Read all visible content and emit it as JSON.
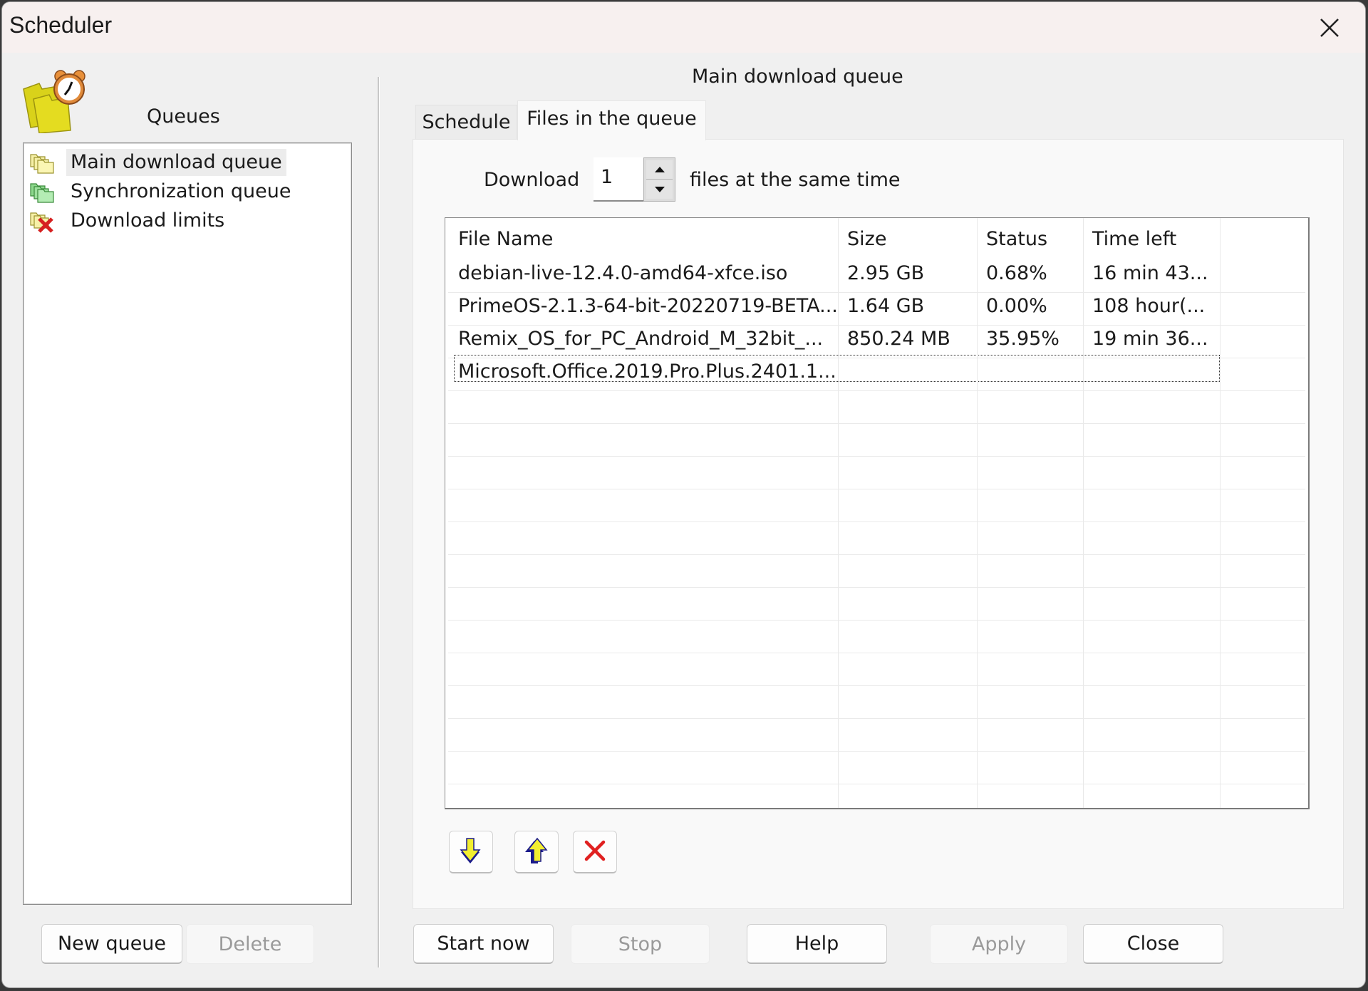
{
  "window": {
    "title": "Scheduler",
    "close_icon": "close-icon"
  },
  "sidebar": {
    "header_label": "Queues",
    "header_icon": "alarm-clock-folder-icon",
    "items": [
      {
        "label": "Main download queue",
        "icon": "yellow-folders-icon",
        "selected": true
      },
      {
        "label": "Synchronization queue",
        "icon": "green-folders-icon",
        "selected": false
      },
      {
        "label": "Download limits",
        "icon": "folders-red-x-icon",
        "selected": false
      }
    ],
    "new_queue_label": "New queue",
    "delete_label": "Delete"
  },
  "main": {
    "queue_title": "Main download queue",
    "tabs": [
      {
        "label": "Schedule",
        "active": false
      },
      {
        "label": "Files in the queue",
        "active": true
      }
    ],
    "concurrency": {
      "prefix": "Download",
      "value": "1",
      "suffix": "files at the same time"
    },
    "table": {
      "columns": [
        "File Name",
        "Size",
        "Status",
        "Time left"
      ],
      "rows": [
        {
          "name": "debian-live-12.4.0-amd64-xfce.iso",
          "size": "2.95  GB",
          "status": "0.68%",
          "time_left": "16 min 43..."
        },
        {
          "name": "PrimeOS-2.1.3-64-bit-20220719-BETA...",
          "size": "1.64  GB",
          "status": "0.00%",
          "time_left": "108 hour(..."
        },
        {
          "name": "Remix_OS_for_PC_Android_M_32bit_...",
          "size": "850.24  MB",
          "status": "35.95%",
          "time_left": "19 min 36..."
        },
        {
          "name": "Microsoft.Office.2019.Pro.Plus.2401.1...",
          "size": "",
          "status": "",
          "time_left": ""
        }
      ],
      "focused_row": 3
    },
    "row_actions": [
      {
        "name": "move-down",
        "icon": "yellow-arrow-down-icon"
      },
      {
        "name": "move-up",
        "icon": "yellow-arrow-up-icon"
      },
      {
        "name": "remove",
        "icon": "red-x-icon"
      }
    ]
  },
  "footer": {
    "start_now_label": "Start now",
    "stop_label": "Stop",
    "help_label": "Help",
    "apply_label": "Apply",
    "close_label": "Close"
  }
}
